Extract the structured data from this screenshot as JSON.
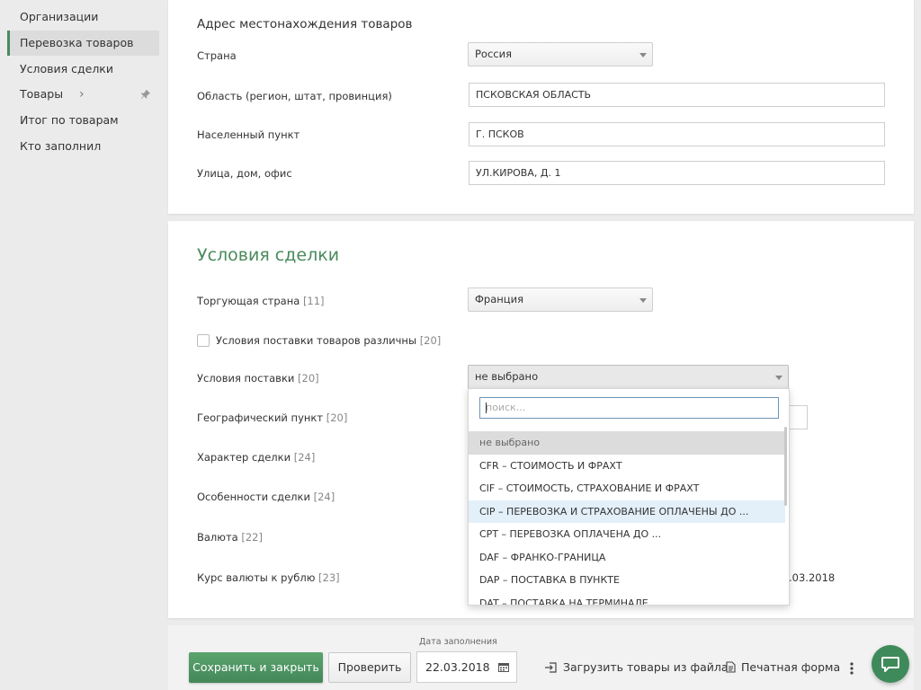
{
  "sidebar": {
    "items": [
      {
        "label": "Организации"
      },
      {
        "label": "Перевозка товаров"
      },
      {
        "label": "Условия сделки"
      },
      {
        "label": "Товары"
      },
      {
        "label": "Итог по товарам"
      },
      {
        "label": "Кто заполнил"
      }
    ],
    "chevron": "›"
  },
  "address": {
    "title": "Адрес местонахождения товаров",
    "country_label": "Страна",
    "country_value": "Россия",
    "region_label": "Область (регион, штат, провинция)",
    "region_value": "ПСКОВСКАЯ ОБЛАСТЬ",
    "city_label": "Населенный пункт",
    "city_value": "Г. ПСКОВ",
    "street_label": "Улица, дом, офис",
    "street_value": "УЛ.КИРОВА, Д. 1"
  },
  "deal": {
    "title": "Условия сделки",
    "trade_country_label": "Торгующая страна",
    "trade_country_num": "[11]",
    "trade_country_value": "Франция",
    "diff_terms_label": "Условия поставки товаров различны",
    "diff_terms_num": "[20]",
    "delivery_terms_label": "Условия поставки",
    "delivery_terms_num": "[20]",
    "delivery_terms_value": "не выбрано",
    "geo_label": "Географический пункт",
    "geo_num": "[20]",
    "character_label": "Характер сделки",
    "character_num": "[24]",
    "features_label": "Особенности сделки",
    "features_num": "[24]",
    "currency_label": "Валюта",
    "currency_num": "[22]",
    "rate_label": "Курс валюты к рублю",
    "rate_num": "[23]",
    "rate_date_fragment": ".03.2018"
  },
  "dropdown": {
    "search_placeholder": "поиск...",
    "options": [
      "не выбрано",
      "CFR – СТОИМОСТЬ И ФРАХТ",
      "CIF – СТОИМОСТЬ, СТРАХОВАНИЕ И ФРАХТ",
      "CIP – ПЕРЕВОЗКА И СТРАХОВАНИЕ ОПЛАЧЕНЫ ДО ...",
      "CPT – ПЕРЕВОЗКА ОПЛАЧЕНА ДО ...",
      "DAF – ФРАНКО-ГРАНИЦА",
      "DAP – ПОСТАВКА В ПУНКТЕ",
      "DAT – ПОСТАВКА НА ТЕРМИНАЛЕ"
    ],
    "selected_index": 0,
    "hover_index": 3
  },
  "footer": {
    "save_label": "Сохранить и закрыть",
    "check_label": "Проверить",
    "date_label": "Дата заполнения",
    "date_value": "22.03.2018",
    "load_label": "Загрузить товары из файла",
    "print_label": "Печатная форма"
  },
  "colors": {
    "accent": "#4a8a5c",
    "primary_button": "#4f9764",
    "hover_row": "#e3eff9"
  }
}
